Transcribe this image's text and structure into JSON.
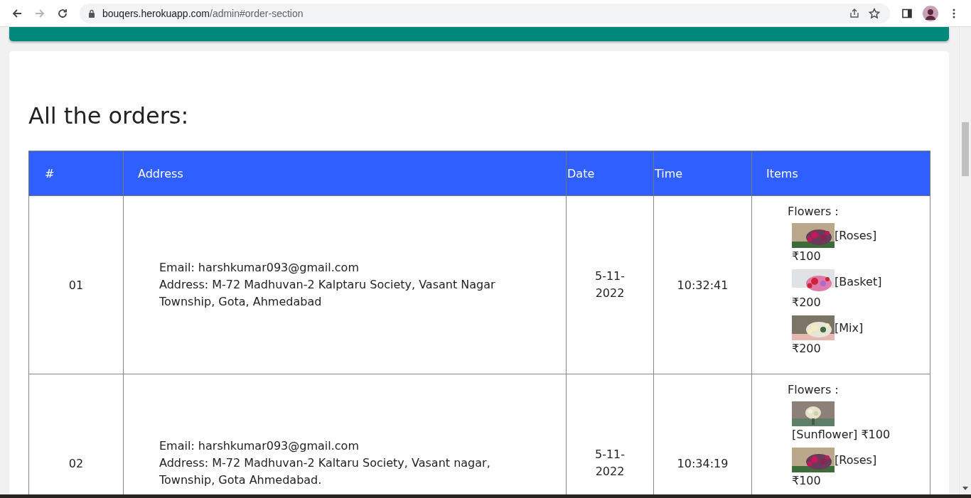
{
  "browser": {
    "url_host": "bouqers.herokuapp.com",
    "url_path": "/admin#order-section",
    "forward_disabled": true
  },
  "heading": "All the orders:",
  "table": {
    "columns": [
      {
        "label": "#"
      },
      {
        "label": "Address"
      },
      {
        "label": "Date"
      },
      {
        "label": "Time"
      },
      {
        "label": "Items"
      }
    ],
    "rows": [
      {
        "number": "01",
        "email": "Email: harshkumar093@gmail.com",
        "address": "Address: M-72 Madhuvan-2 Kalptaru Society, Vasant Nagar Township, Gota, Ahmedabad",
        "date": "5-11-2022",
        "time": "10:32:41",
        "items_heading": "Flowers :",
        "items": [
          {
            "kind": "inline",
            "name": "[Roses]",
            "price": "₹100"
          },
          {
            "kind": "inline",
            "name": "[Basket]",
            "price": "₹200"
          },
          {
            "kind": "inline",
            "name": "[Mix]",
            "price": "₹200"
          }
        ]
      },
      {
        "number": "02",
        "email": "Email: harshkumar093@gmail.com",
        "address": "Address: M-72 Madhuvan-2 Kaltaru Society, Vasant nagar, Township, Gota Ahmedabad.",
        "date": "5-11-2022",
        "time": "10:34:19",
        "items_heading": "Flowers :",
        "items": [
          {
            "kind": "stacked",
            "name": "[Sunflower]",
            "price": "₹100"
          },
          {
            "kind": "inline",
            "name": "[Roses]",
            "price": "₹100"
          }
        ]
      }
    ]
  }
}
